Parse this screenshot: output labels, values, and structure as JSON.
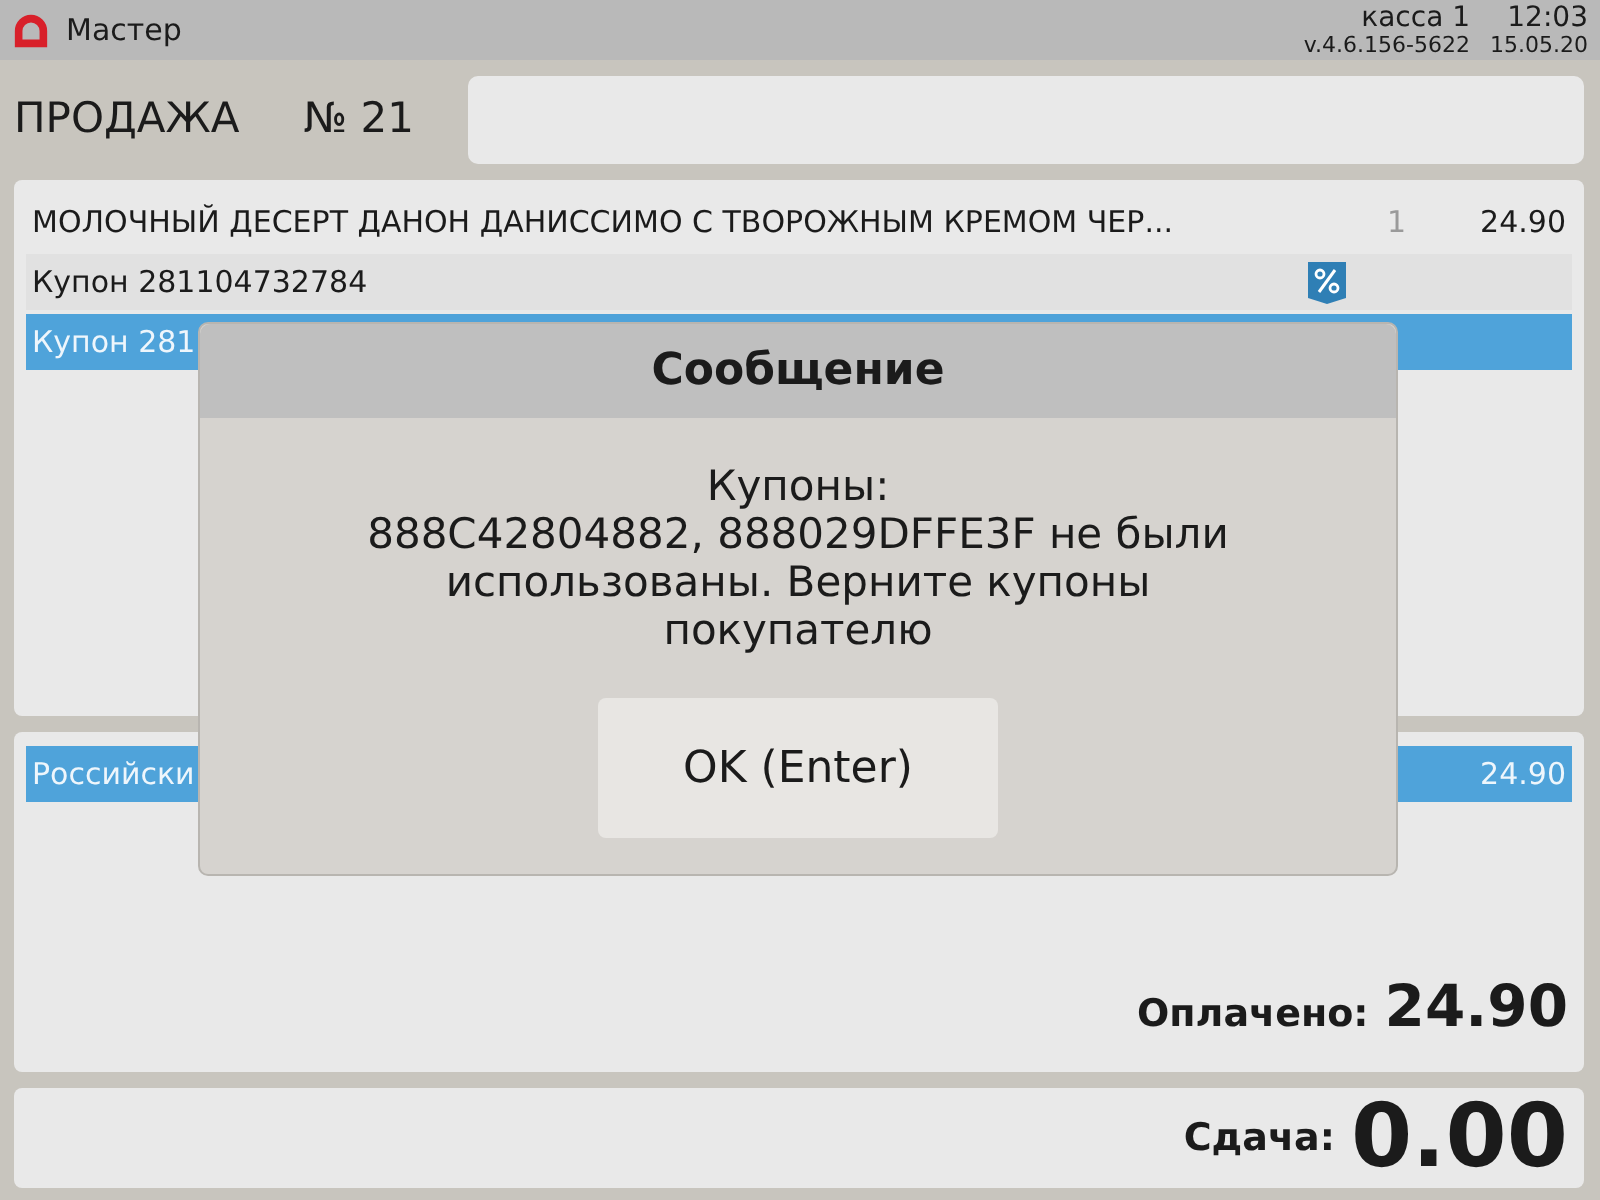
{
  "title_bar": {
    "app_title": "Мастер",
    "register": "касса 1",
    "version": "v.4.6.156-5622",
    "time": "12:03",
    "date": "15.05.20"
  },
  "sale": {
    "title": "ПРОДАЖА",
    "number": "№ 21"
  },
  "items": [
    {
      "kind": "product",
      "name": "МОЛОЧНЫЙ ДЕСЕРТ ДАНОН ДАНИССИМО С ТВОРОЖНЫМ КРЕМОМ ЧЕР...",
      "qty": "1",
      "price": "24.90",
      "selected": false
    },
    {
      "kind": "coupon",
      "name": "Купон 281104732784",
      "selected": false
    },
    {
      "kind": "coupon",
      "name": "Купон 281",
      "selected": true
    }
  ],
  "payments": [
    {
      "name": "Российски",
      "amount": "24.90",
      "selected": true
    }
  ],
  "paid": {
    "label": "Оплачено:",
    "amount": "24.90"
  },
  "change": {
    "label": "Сдача:",
    "amount": "0.00"
  },
  "dialog": {
    "title": "Сообщение",
    "message": "Купоны:\n888C42804882, 888029DFFE3F не были\nиспользованы. Верните купоны\nпокупателю",
    "button": "OK (Enter)"
  }
}
